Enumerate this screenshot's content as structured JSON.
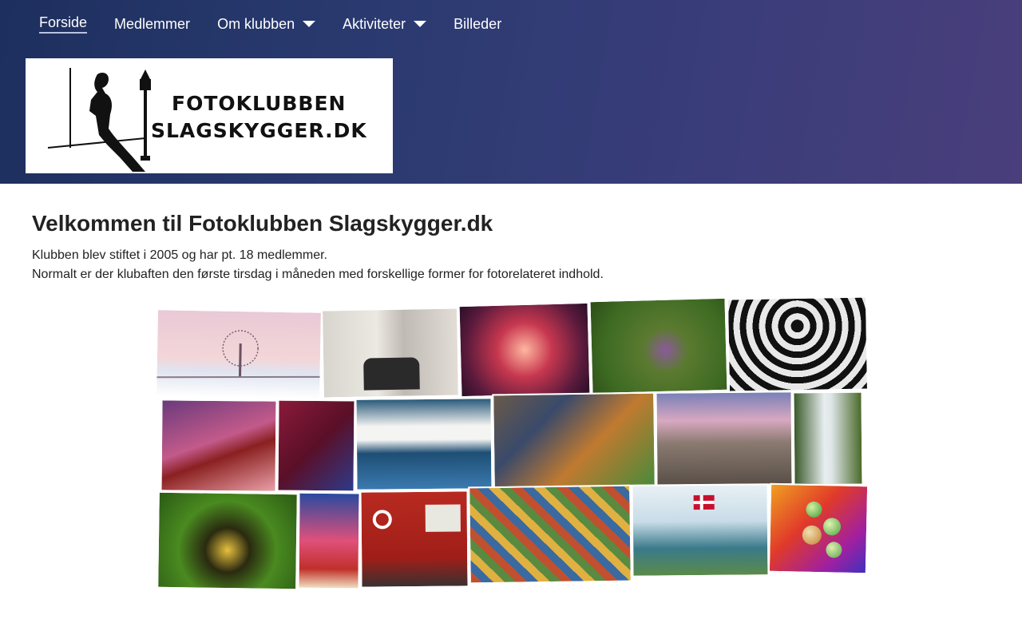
{
  "nav": {
    "items": [
      {
        "label": "Forside",
        "active": true,
        "dropdown": false
      },
      {
        "label": "Medlemmer",
        "active": false,
        "dropdown": false
      },
      {
        "label": "Om klubben",
        "active": false,
        "dropdown": true
      },
      {
        "label": "Aktiviteter",
        "active": false,
        "dropdown": true
      },
      {
        "label": "Billeder",
        "active": false,
        "dropdown": false
      }
    ]
  },
  "logo": {
    "line1": "FOTOKLUBBEN",
    "line2": "SLAGSKYGGER.DK"
  },
  "main": {
    "title": "Velkommen til Fotoklubben Slagskygger.dk",
    "paragraph1": "Klubben blev stiftet i 2005 og har pt. 18 medlemmer.",
    "paragraph2": "Normalt er der klubaften den første tirsdag i måneden med forskellige former for fotorelateret indhold."
  },
  "collage": {
    "photos": [
      "winter-tree-photo",
      "bridge-pillars-photo",
      "backlit-flower-photo",
      "pasque-flower-photo",
      "chairs-photo",
      "red-bridge-photo",
      "singer-photo",
      "boats-photo",
      "market-vendor-photo",
      "dunes-photo",
      "waterfall-photo",
      "butterfly-photo",
      "graffiti-photo",
      "red-house-bicycle-photo",
      "painting-seller-photo",
      "danish-flag-coast-photo",
      "color-bubbles-photo"
    ]
  }
}
